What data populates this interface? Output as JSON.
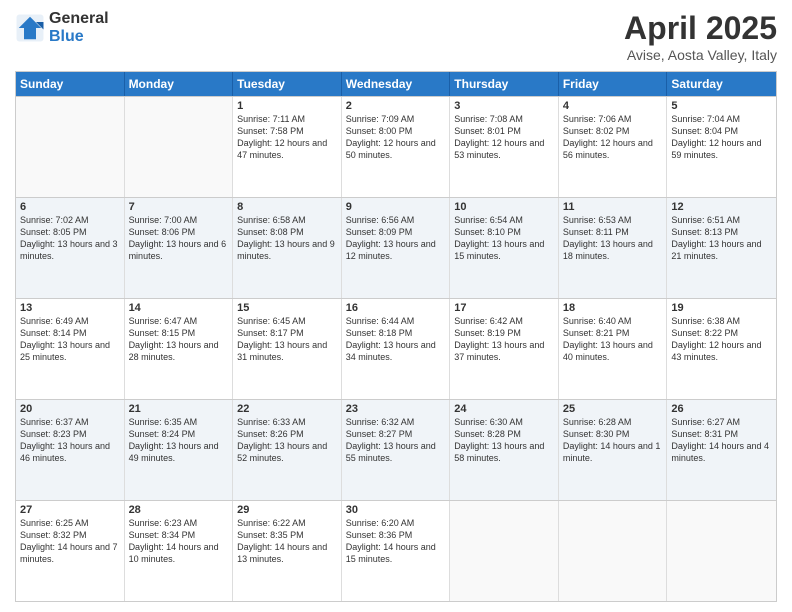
{
  "logo": {
    "line1": "General",
    "line2": "Blue"
  },
  "title": "April 2025",
  "subtitle": "Avise, Aosta Valley, Italy",
  "header": {
    "days": [
      "Sunday",
      "Monday",
      "Tuesday",
      "Wednesday",
      "Thursday",
      "Friday",
      "Saturday"
    ]
  },
  "weeks": [
    {
      "cells": [
        {
          "day": "",
          "empty": true
        },
        {
          "day": "",
          "empty": true
        },
        {
          "day": "1",
          "sunrise": "Sunrise: 7:11 AM",
          "sunset": "Sunset: 7:58 PM",
          "daylight": "Daylight: 12 hours and 47 minutes."
        },
        {
          "day": "2",
          "sunrise": "Sunrise: 7:09 AM",
          "sunset": "Sunset: 8:00 PM",
          "daylight": "Daylight: 12 hours and 50 minutes."
        },
        {
          "day": "3",
          "sunrise": "Sunrise: 7:08 AM",
          "sunset": "Sunset: 8:01 PM",
          "daylight": "Daylight: 12 hours and 53 minutes."
        },
        {
          "day": "4",
          "sunrise": "Sunrise: 7:06 AM",
          "sunset": "Sunset: 8:02 PM",
          "daylight": "Daylight: 12 hours and 56 minutes."
        },
        {
          "day": "5",
          "sunrise": "Sunrise: 7:04 AM",
          "sunset": "Sunset: 8:04 PM",
          "daylight": "Daylight: 12 hours and 59 minutes."
        }
      ]
    },
    {
      "cells": [
        {
          "day": "6",
          "sunrise": "Sunrise: 7:02 AM",
          "sunset": "Sunset: 8:05 PM",
          "daylight": "Daylight: 13 hours and 3 minutes."
        },
        {
          "day": "7",
          "sunrise": "Sunrise: 7:00 AM",
          "sunset": "Sunset: 8:06 PM",
          "daylight": "Daylight: 13 hours and 6 minutes."
        },
        {
          "day": "8",
          "sunrise": "Sunrise: 6:58 AM",
          "sunset": "Sunset: 8:08 PM",
          "daylight": "Daylight: 13 hours and 9 minutes."
        },
        {
          "day": "9",
          "sunrise": "Sunrise: 6:56 AM",
          "sunset": "Sunset: 8:09 PM",
          "daylight": "Daylight: 13 hours and 12 minutes."
        },
        {
          "day": "10",
          "sunrise": "Sunrise: 6:54 AM",
          "sunset": "Sunset: 8:10 PM",
          "daylight": "Daylight: 13 hours and 15 minutes."
        },
        {
          "day": "11",
          "sunrise": "Sunrise: 6:53 AM",
          "sunset": "Sunset: 8:11 PM",
          "daylight": "Daylight: 13 hours and 18 minutes."
        },
        {
          "day": "12",
          "sunrise": "Sunrise: 6:51 AM",
          "sunset": "Sunset: 8:13 PM",
          "daylight": "Daylight: 13 hours and 21 minutes."
        }
      ]
    },
    {
      "cells": [
        {
          "day": "13",
          "sunrise": "Sunrise: 6:49 AM",
          "sunset": "Sunset: 8:14 PM",
          "daylight": "Daylight: 13 hours and 25 minutes."
        },
        {
          "day": "14",
          "sunrise": "Sunrise: 6:47 AM",
          "sunset": "Sunset: 8:15 PM",
          "daylight": "Daylight: 13 hours and 28 minutes."
        },
        {
          "day": "15",
          "sunrise": "Sunrise: 6:45 AM",
          "sunset": "Sunset: 8:17 PM",
          "daylight": "Daylight: 13 hours and 31 minutes."
        },
        {
          "day": "16",
          "sunrise": "Sunrise: 6:44 AM",
          "sunset": "Sunset: 8:18 PM",
          "daylight": "Daylight: 13 hours and 34 minutes."
        },
        {
          "day": "17",
          "sunrise": "Sunrise: 6:42 AM",
          "sunset": "Sunset: 8:19 PM",
          "daylight": "Daylight: 13 hours and 37 minutes."
        },
        {
          "day": "18",
          "sunrise": "Sunrise: 6:40 AM",
          "sunset": "Sunset: 8:21 PM",
          "daylight": "Daylight: 13 hours and 40 minutes."
        },
        {
          "day": "19",
          "sunrise": "Sunrise: 6:38 AM",
          "sunset": "Sunset: 8:22 PM",
          "daylight": "Daylight: 12 hours and 43 minutes."
        }
      ]
    },
    {
      "cells": [
        {
          "day": "20",
          "sunrise": "Sunrise: 6:37 AM",
          "sunset": "Sunset: 8:23 PM",
          "daylight": "Daylight: 13 hours and 46 minutes."
        },
        {
          "day": "21",
          "sunrise": "Sunrise: 6:35 AM",
          "sunset": "Sunset: 8:24 PM",
          "daylight": "Daylight: 13 hours and 49 minutes."
        },
        {
          "day": "22",
          "sunrise": "Sunrise: 6:33 AM",
          "sunset": "Sunset: 8:26 PM",
          "daylight": "Daylight: 13 hours and 52 minutes."
        },
        {
          "day": "23",
          "sunrise": "Sunrise: 6:32 AM",
          "sunset": "Sunset: 8:27 PM",
          "daylight": "Daylight: 13 hours and 55 minutes."
        },
        {
          "day": "24",
          "sunrise": "Sunrise: 6:30 AM",
          "sunset": "Sunset: 8:28 PM",
          "daylight": "Daylight: 13 hours and 58 minutes."
        },
        {
          "day": "25",
          "sunrise": "Sunrise: 6:28 AM",
          "sunset": "Sunset: 8:30 PM",
          "daylight": "Daylight: 14 hours and 1 minute."
        },
        {
          "day": "26",
          "sunrise": "Sunrise: 6:27 AM",
          "sunset": "Sunset: 8:31 PM",
          "daylight": "Daylight: 14 hours and 4 minutes."
        }
      ]
    },
    {
      "cells": [
        {
          "day": "27",
          "sunrise": "Sunrise: 6:25 AM",
          "sunset": "Sunset: 8:32 PM",
          "daylight": "Daylight: 14 hours and 7 minutes."
        },
        {
          "day": "28",
          "sunrise": "Sunrise: 6:23 AM",
          "sunset": "Sunset: 8:34 PM",
          "daylight": "Daylight: 14 hours and 10 minutes."
        },
        {
          "day": "29",
          "sunrise": "Sunrise: 6:22 AM",
          "sunset": "Sunset: 8:35 PM",
          "daylight": "Daylight: 14 hours and 13 minutes."
        },
        {
          "day": "30",
          "sunrise": "Sunrise: 6:20 AM",
          "sunset": "Sunset: 8:36 PM",
          "daylight": "Daylight: 14 hours and 15 minutes."
        },
        {
          "day": "",
          "empty": true
        },
        {
          "day": "",
          "empty": true
        },
        {
          "day": "",
          "empty": true
        }
      ]
    }
  ]
}
